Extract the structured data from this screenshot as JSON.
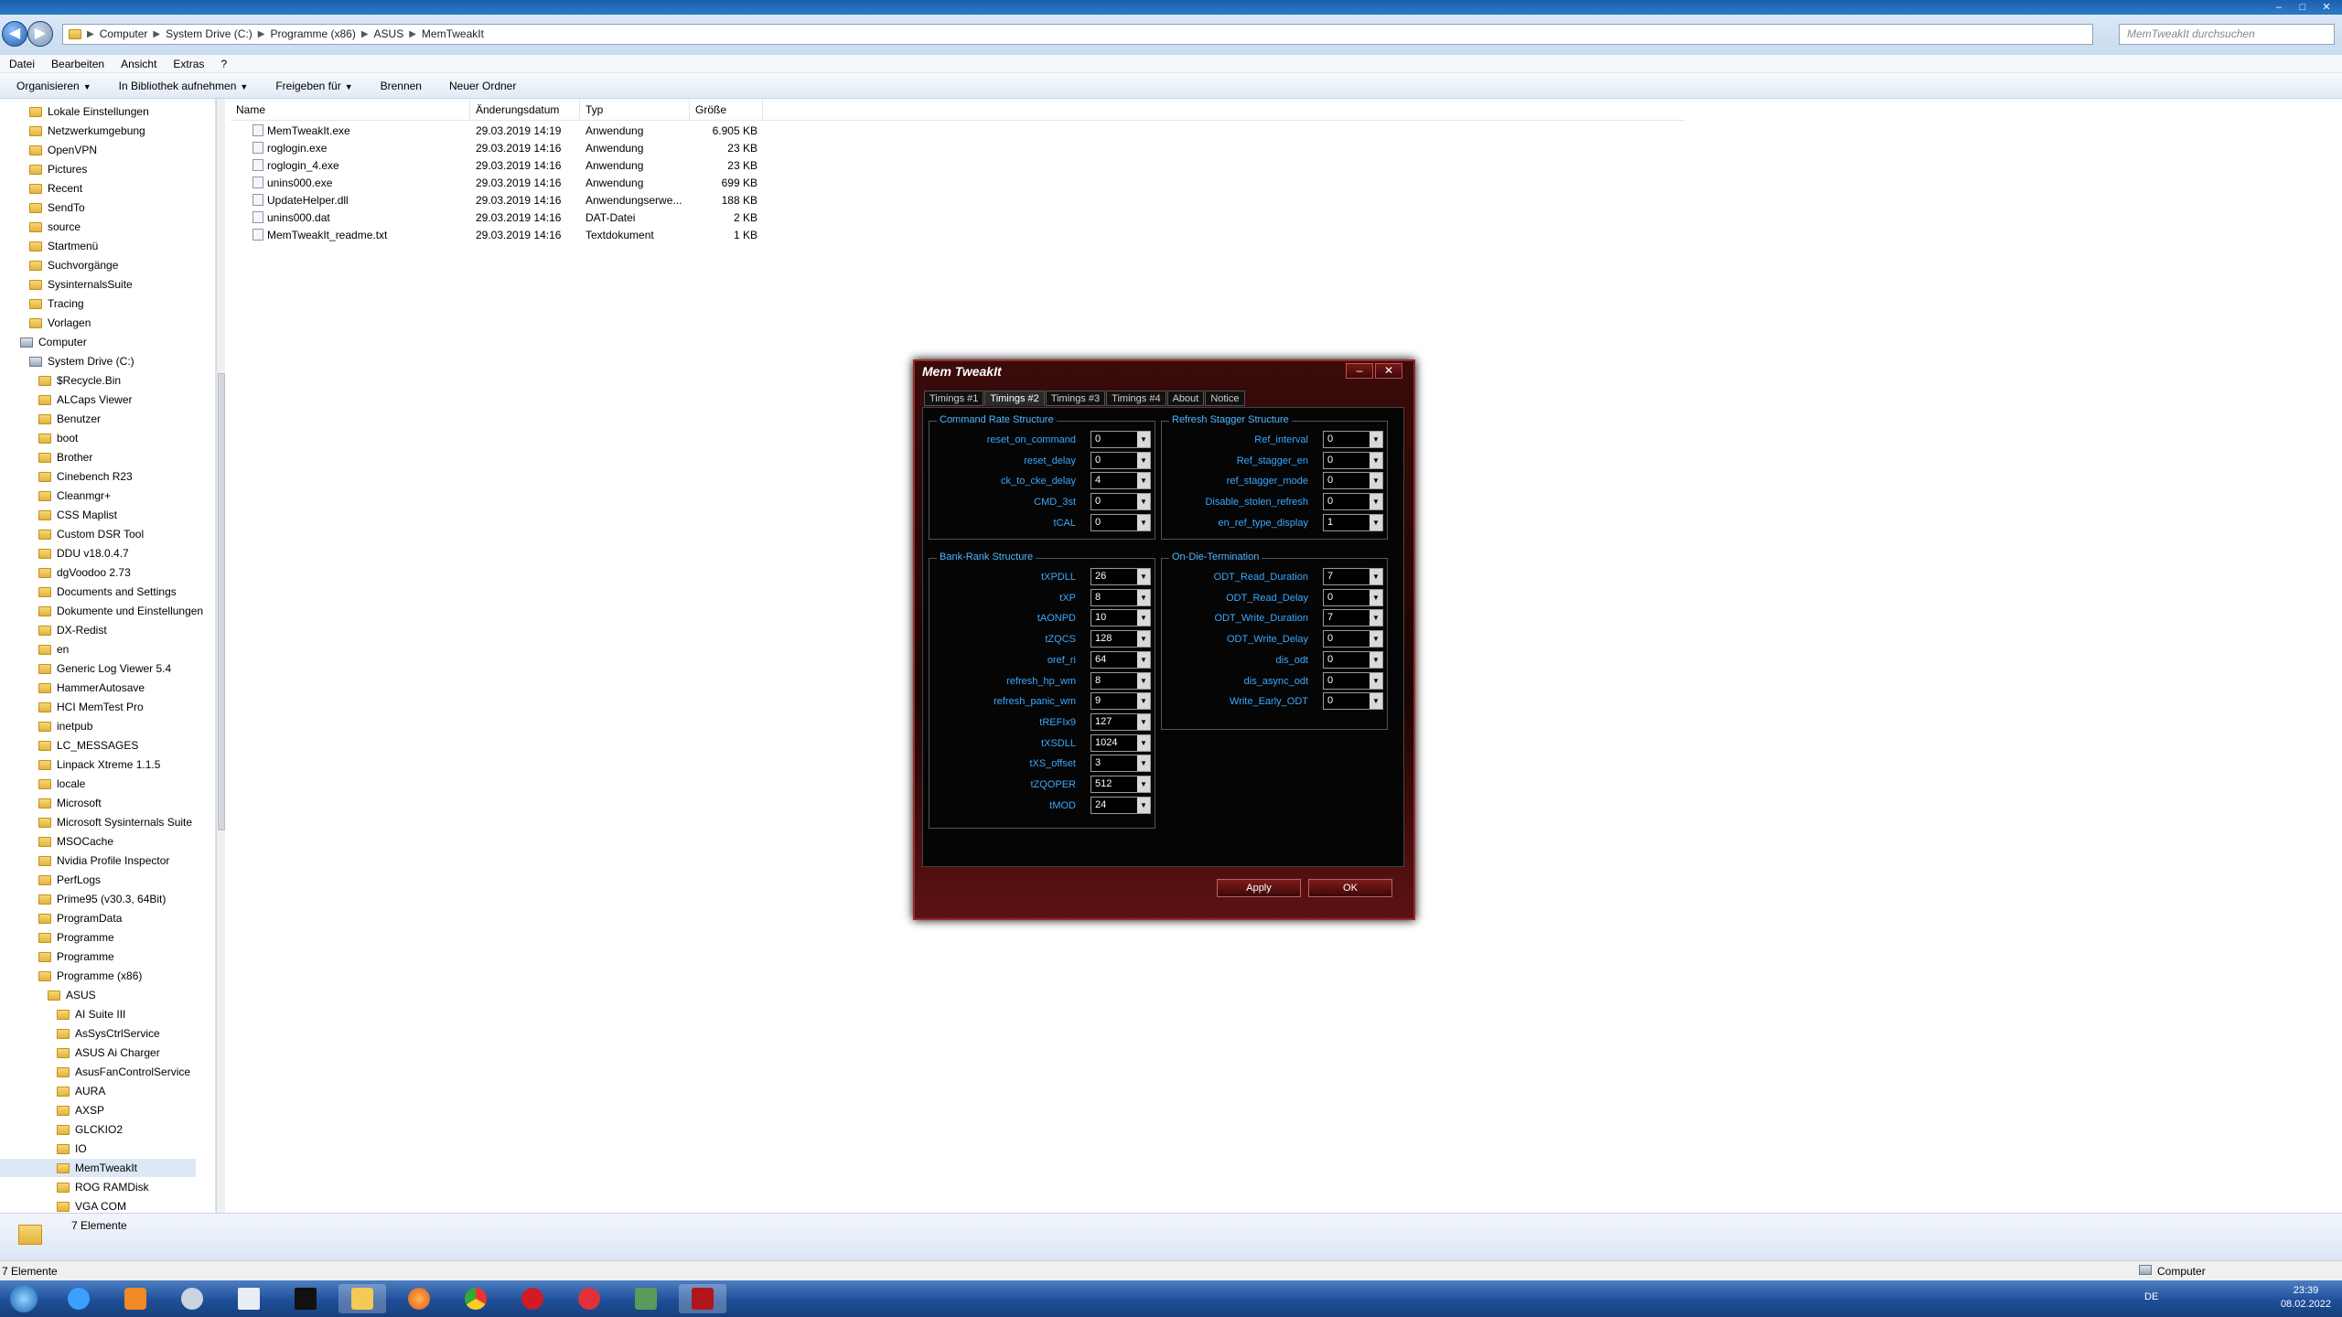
{
  "window": {
    "title": "MemTweakIt"
  },
  "address": {
    "path": [
      "Computer",
      "System Drive (C:)",
      "Programme (x86)",
      "ASUS",
      "MemTweakIt"
    ],
    "search_placeholder": "MemTweakIt durchsuchen"
  },
  "menu": [
    "Datei",
    "Bearbeiten",
    "Ansicht",
    "Extras",
    "?"
  ],
  "toolbar": [
    "Organisieren",
    "In Bibliothek aufnehmen",
    "Freigeben für",
    "Brennen",
    "Neuer Ordner"
  ],
  "tree": [
    {
      "label": "Lokale Einstellungen",
      "indent": 1
    },
    {
      "label": "Netzwerkumgebung",
      "indent": 1
    },
    {
      "label": "OpenVPN",
      "indent": 1
    },
    {
      "label": "Pictures",
      "indent": 1
    },
    {
      "label": "Recent",
      "indent": 1
    },
    {
      "label": "SendTo",
      "indent": 1
    },
    {
      "label": "source",
      "indent": 1
    },
    {
      "label": "Startmenü",
      "indent": 1
    },
    {
      "label": "Suchvorgänge",
      "indent": 1
    },
    {
      "label": "SysinternalsSuite",
      "indent": 1
    },
    {
      "label": "Tracing",
      "indent": 1
    },
    {
      "label": "Vorlagen",
      "indent": 1
    },
    {
      "label": "Computer",
      "indent": 0
    },
    {
      "label": "System Drive (C:)",
      "indent": 1
    },
    {
      "label": "$Recycle.Bin",
      "indent": 2
    },
    {
      "label": "ALCaps Viewer",
      "indent": 2
    },
    {
      "label": "Benutzer",
      "indent": 2
    },
    {
      "label": "boot",
      "indent": 2
    },
    {
      "label": "Brother",
      "indent": 2
    },
    {
      "label": "Cinebench R23",
      "indent": 2
    },
    {
      "label": "Cleanmgr+",
      "indent": 2
    },
    {
      "label": "CSS Maplist",
      "indent": 2
    },
    {
      "label": "Custom DSR Tool",
      "indent": 2
    },
    {
      "label": "DDU v18.0.4.7",
      "indent": 2
    },
    {
      "label": "dgVoodoo 2.73",
      "indent": 2
    },
    {
      "label": "Documents and Settings",
      "indent": 2
    },
    {
      "label": "Dokumente und Einstellungen",
      "indent": 2
    },
    {
      "label": "DX-Redist",
      "indent": 2
    },
    {
      "label": "en",
      "indent": 2
    },
    {
      "label": "Generic Log Viewer 5.4",
      "indent": 2
    },
    {
      "label": "HammerAutosave",
      "indent": 2
    },
    {
      "label": "HCI MemTest Pro",
      "indent": 2
    },
    {
      "label": "inetpub",
      "indent": 2
    },
    {
      "label": "LC_MESSAGES",
      "indent": 2
    },
    {
      "label": "Linpack Xtreme 1.1.5",
      "indent": 2
    },
    {
      "label": "locale",
      "indent": 2
    },
    {
      "label": "Microsoft",
      "indent": 2
    },
    {
      "label": "Microsoft Sysinternals Suite",
      "indent": 2
    },
    {
      "label": "MSOCache",
      "indent": 2
    },
    {
      "label": "Nvidia Profile Inspector",
      "indent": 2
    },
    {
      "label": "PerfLogs",
      "indent": 2
    },
    {
      "label": "Prime95 (v30.3, 64Bit)",
      "indent": 2
    },
    {
      "label": "ProgramData",
      "indent": 2
    },
    {
      "label": "Programme",
      "indent": 2
    },
    {
      "label": "Programme",
      "indent": 2
    },
    {
      "label": "Programme (x86)",
      "indent": 2
    },
    {
      "label": "ASUS",
      "indent": 3
    },
    {
      "label": "AI Suite III",
      "indent": 4
    },
    {
      "label": "AsSysCtrlService",
      "indent": 4
    },
    {
      "label": "ASUS Ai Charger",
      "indent": 4
    },
    {
      "label": "AsusFanControlService",
      "indent": 4
    },
    {
      "label": "AURA",
      "indent": 4
    },
    {
      "label": "AXSP",
      "indent": 4
    },
    {
      "label": "GLCKIO2",
      "indent": 4
    },
    {
      "label": "IO",
      "indent": 4
    },
    {
      "label": "MemTweakIt",
      "indent": 4
    },
    {
      "label": "ROG RAMDisk",
      "indent": 4
    },
    {
      "label": "VGA COM",
      "indent": 4
    }
  ],
  "columns": [
    "Name",
    "Änderungsdatum",
    "Typ",
    "Größe"
  ],
  "files": [
    {
      "name": "MemTweakIt.exe",
      "date": "29.03.2019 14:19",
      "type": "Anwendung",
      "size": "6.905 KB"
    },
    {
      "name": "roglogin.exe",
      "date": "29.03.2019 14:16",
      "type": "Anwendung",
      "size": "23 KB"
    },
    {
      "name": "roglogin_4.exe",
      "date": "29.03.2019 14:16",
      "type": "Anwendung",
      "size": "23 KB"
    },
    {
      "name": "unins000.exe",
      "date": "29.03.2019 14:16",
      "type": "Anwendung",
      "size": "699 KB"
    },
    {
      "name": "UpdateHelper.dll",
      "date": "29.03.2019 14:16",
      "type": "Anwendungserwe...",
      "size": "188 KB"
    },
    {
      "name": "unins000.dat",
      "date": "29.03.2019 14:16",
      "type": "DAT-Datei",
      "size": "2 KB"
    },
    {
      "name": "MemTweakIt_readme.txt",
      "date": "29.03.2019 14:16",
      "type": "Textdokument",
      "size": "1 KB"
    }
  ],
  "details": {
    "count": "7 Elemente"
  },
  "status": {
    "left": "7 Elemente",
    "right": "Computer"
  },
  "tray": {
    "lang": "DE",
    "time": "23:39",
    "date": "08.02.2022"
  },
  "memtweakit": {
    "title": "Mem TweakIt",
    "tabs": [
      "Timings #1",
      "Timings #2",
      "Timings #3",
      "Timings #4",
      "About",
      "Notice"
    ],
    "active_tab": 1,
    "groups": {
      "command_rate": {
        "title": "Command Rate Structure",
        "fields": [
          {
            "label": "reset_on_command",
            "value": "0"
          },
          {
            "label": "reset_delay",
            "value": "0"
          },
          {
            "label": "ck_to_cke_delay",
            "value": "4"
          },
          {
            "label": "CMD_3st",
            "value": "0"
          },
          {
            "label": "tCAL",
            "value": "0"
          }
        ]
      },
      "refresh_stagger": {
        "title": "Refresh Stagger Structure",
        "fields": [
          {
            "label": "Ref_interval",
            "value": "0"
          },
          {
            "label": "Ref_stagger_en",
            "value": "0"
          },
          {
            "label": "ref_stagger_mode",
            "value": "0"
          },
          {
            "label": "Disable_stolen_refresh",
            "value": "0"
          },
          {
            "label": "en_ref_type_display",
            "value": "1"
          }
        ]
      },
      "bank_rank": {
        "title": "Bank-Rank Structure",
        "fields": [
          {
            "label": "tXPDLL",
            "value": "26"
          },
          {
            "label": "tXP",
            "value": "8"
          },
          {
            "label": "tAONPD",
            "value": "10"
          },
          {
            "label": "tZQCS",
            "value": "128"
          },
          {
            "label": "oref_ri",
            "value": "64"
          },
          {
            "label": "refresh_hp_wm",
            "value": "8"
          },
          {
            "label": "refresh_panic_wm",
            "value": "9"
          },
          {
            "label": "tREFIx9",
            "value": "127"
          },
          {
            "label": "tXSDLL",
            "value": "1024"
          },
          {
            "label": "tXS_offset",
            "value": "3"
          },
          {
            "label": "tZQOPER",
            "value": "512"
          },
          {
            "label": "tMOD",
            "value": "24"
          }
        ]
      },
      "odt": {
        "title": "On-Die-Termination",
        "fields": [
          {
            "label": "ODT_Read_Duration",
            "value": "7"
          },
          {
            "label": "ODT_Read_Delay",
            "value": "0"
          },
          {
            "label": "ODT_Write_Duration",
            "value": "7"
          },
          {
            "label": "ODT_Write_Delay",
            "value": "0"
          },
          {
            "label": "dis_odt",
            "value": "0"
          },
          {
            "label": "dis_async_odt",
            "value": "0"
          },
          {
            "label": "Write_Early_ODT",
            "value": "0"
          }
        ]
      }
    },
    "buttons": {
      "apply": "Apply",
      "ok": "OK"
    }
  }
}
